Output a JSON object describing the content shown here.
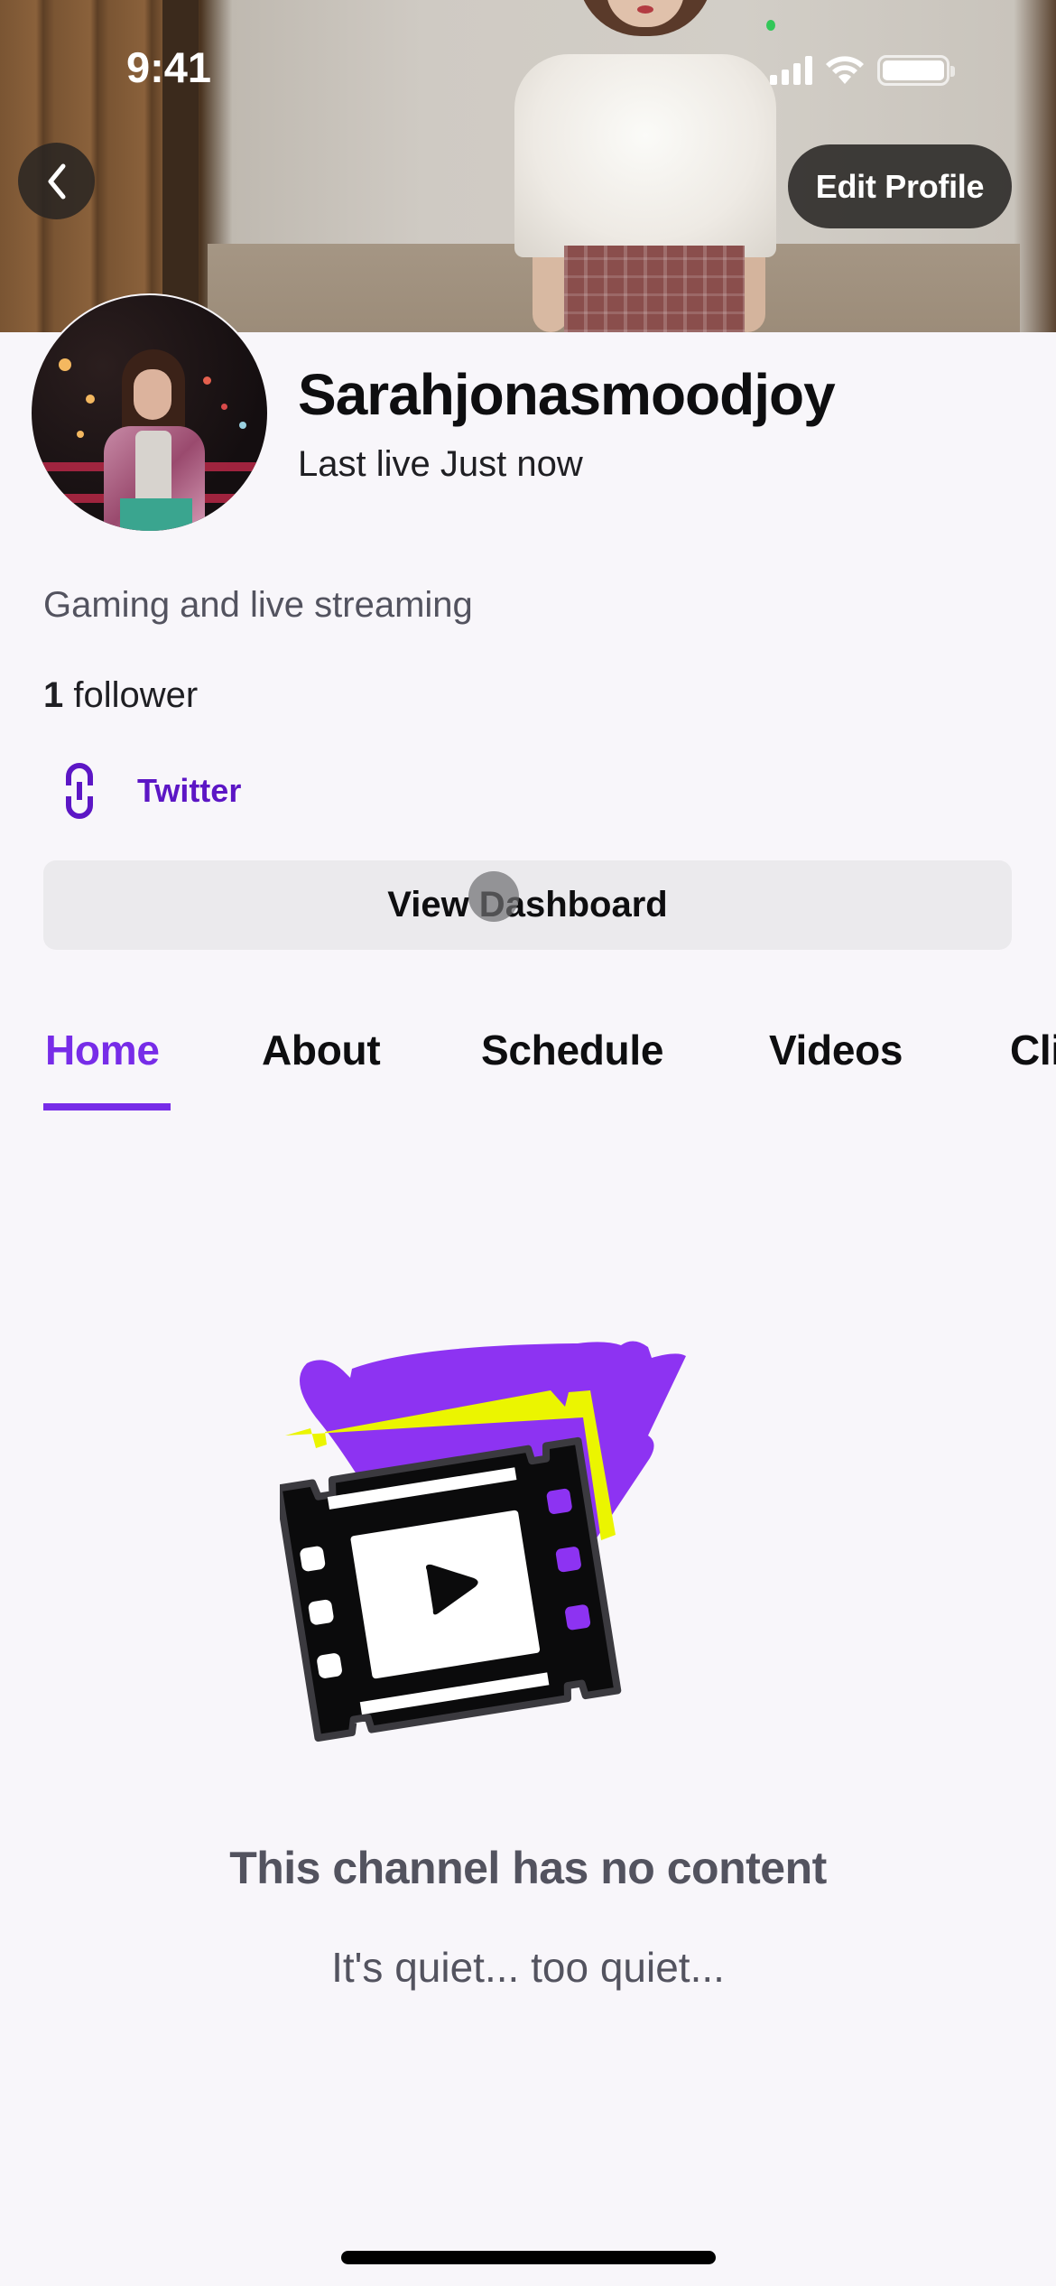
{
  "status_bar": {
    "time": "9:41",
    "icons": [
      "cellular-signal-icon",
      "wifi-icon",
      "battery-icon"
    ]
  },
  "header": {
    "back_icon": "chevron-left-icon",
    "edit_profile_label": "Edit Profile"
  },
  "profile": {
    "display_name": "Sarahjonasmoodjoy",
    "last_live": "Last live Just now",
    "bio": "Gaming and live streaming",
    "follower_count": "1",
    "follower_label": "follower",
    "links": [
      {
        "icon": "link-icon",
        "label": "Twitter"
      }
    ],
    "dashboard_button_label": "View Dashboard"
  },
  "tabs": [
    {
      "label": "Home",
      "active": true
    },
    {
      "label": "About",
      "active": false
    },
    {
      "label": "Schedule",
      "active": false
    },
    {
      "label": "Videos",
      "active": false
    },
    {
      "label": "Clips",
      "active": false
    }
  ],
  "empty_state": {
    "illustration": "film-strip-play-icon",
    "title": "This channel has no content",
    "subtitle": "It's quiet... too quiet..."
  },
  "colors": {
    "accent": "#772ce8",
    "link": "#5c16c5",
    "text_primary": "#0e0e10",
    "text_secondary": "#53535f",
    "background": "#f8f6fa",
    "button_bg": "#ebeaed",
    "illustration_purple": "#8d33f2",
    "illustration_yellow": "#ebf500"
  }
}
